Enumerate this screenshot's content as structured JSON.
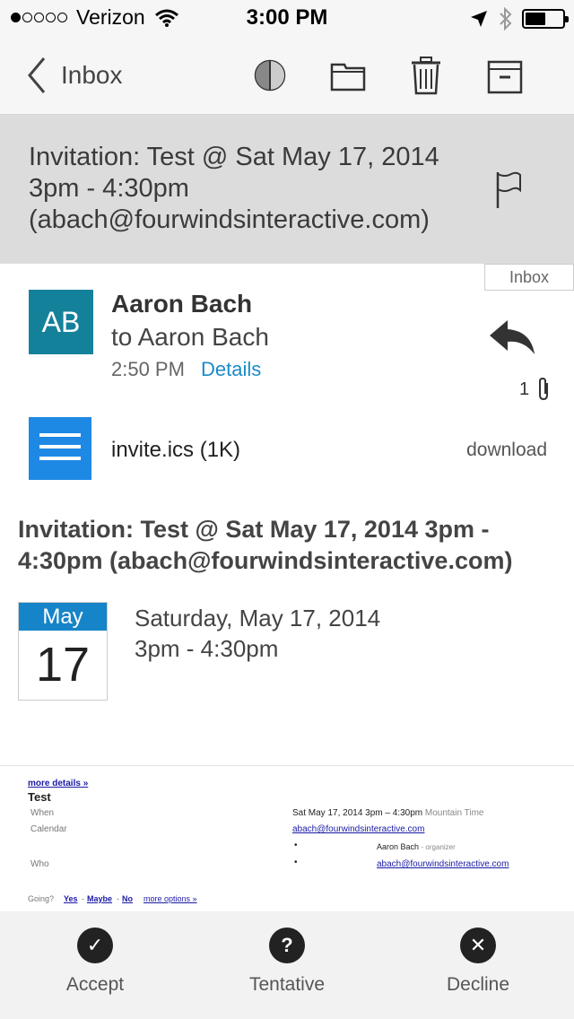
{
  "status_bar": {
    "carrier": "Verizon",
    "time": "3:00 PM",
    "signal_bars_filled": 1,
    "signal_bars_total": 5,
    "battery_level_percent": 55
  },
  "nav": {
    "back_label": "Inbox",
    "icons": [
      "back-chevron-icon",
      "contrast-circle-icon",
      "folder-icon",
      "trash-icon",
      "archive-icon"
    ]
  },
  "message": {
    "subject": "Invitation: Test @ Sat May 17, 2014 3pm - 4:30pm (abach@fourwindsinteractive.com)",
    "folder_badge": "Inbox",
    "avatar_initials": "AB",
    "avatar_color": "#14819b",
    "sender": "Aaron Bach",
    "recipient": "to Aaron Bach",
    "time": "2:50 PM",
    "details_label": "Details",
    "attachment_count": "1",
    "attachment": {
      "name": "invite.ics (1K)",
      "download_label": "download",
      "icon_color": "#1e88e5"
    }
  },
  "event": {
    "title": "Invitation: Test @ Sat May 17, 2014 3pm - 4:30pm (abach@fourwindsinteractive.com)",
    "month": "May",
    "day": "17",
    "date_text": "Saturday, May 17, 2014",
    "time_text": "3pm - 4:30pm",
    "accent_color": "#1684c8"
  },
  "gcal": {
    "more_details": "more details »",
    "title": "Test",
    "when_label": "When",
    "when_value": "Sat May 17, 2014 3pm – 4:30pm",
    "when_tz": "Mountain Time",
    "calendar_label": "Calendar",
    "calendar_value": "abach@fourwindsinteractive.com",
    "who_label": "Who",
    "who_organizer_name": "Aaron Bach",
    "who_organizer_role": "- organizer",
    "who_guest": "abach@fourwindsinteractive.com",
    "going_label": "Going?",
    "yes": "Yes",
    "maybe": "Maybe",
    "no": "No",
    "more_options": "more options »",
    "link_color": "#1a1aa6"
  },
  "rsvp": {
    "accept": "Accept",
    "tentative": "Tentative",
    "decline": "Decline"
  }
}
